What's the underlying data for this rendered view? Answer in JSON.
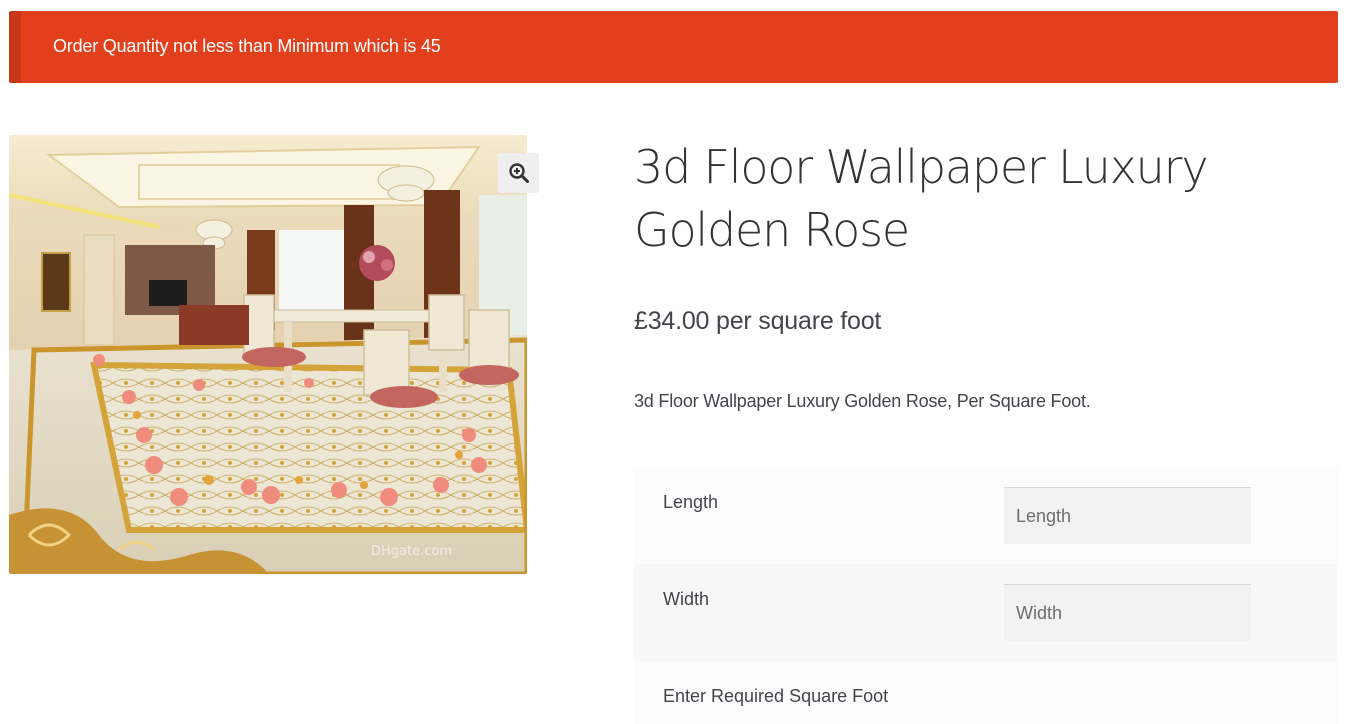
{
  "notice": {
    "message": "Order Quantity not less than Minimum which is 45",
    "color": "#e2401c"
  },
  "product": {
    "title": "3d Floor Wallpaper Luxury Golden Rose",
    "price": "£34.00 per square foot",
    "description": "3d Floor Wallpaper Luxury Golden Rose, Per Square Foot.",
    "image_watermark": "DHgate.com"
  },
  "gallery": {
    "zoom_icon": "magnifier-plus-icon"
  },
  "variations": {
    "length": {
      "label": "Length",
      "placeholder": "Length"
    },
    "width": {
      "label": "Width",
      "placeholder": "Width"
    },
    "square_foot": {
      "label": "Enter Required Square Foot"
    }
  }
}
